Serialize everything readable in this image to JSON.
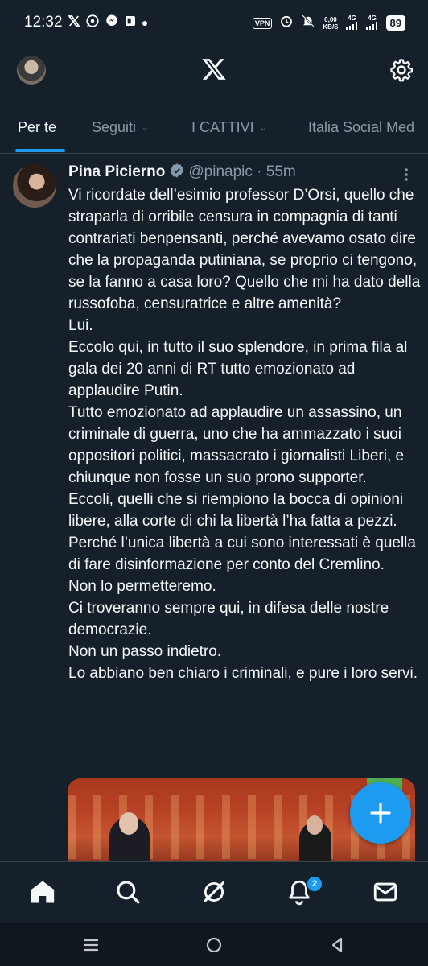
{
  "status_bar": {
    "time": "12:32",
    "left_icons": [
      "x-icon",
      "whatsapp-icon",
      "messenger-icon",
      "app-icon",
      "dot-icon"
    ],
    "vpn": "VPN",
    "net_speed_value": "0,00",
    "net_speed_unit": "KB/S",
    "net1": "4G",
    "net2": "4G",
    "battery": "89"
  },
  "top_bar": {
    "logo": "x-logo-icon",
    "settings_icon": "gear-icon"
  },
  "tabs": [
    {
      "label": "Per te",
      "active": true
    },
    {
      "label": "Seguiti",
      "active": false
    },
    {
      "label": "I CATTIVI",
      "active": false
    },
    {
      "label": "Italia Social Med",
      "active": false
    }
  ],
  "post": {
    "author_name": "Pina Picierno",
    "handle": "@pinapic",
    "separator": "·",
    "time": "55m",
    "lines": [
      "Vi ricordate dell’esimio professor D’Orsi, quello che straparla di orribile censura in compagnia di tanti contrariati benpensanti, perché avevamo osato dire che la propaganda putiniana, se proprio ci tengono, se la fanno a casa loro? Quello che mi ha dato della russofoba, censuratrice e altre amenità?",
      "Lui.",
      "Eccolo qui, in tutto il suo splendore, in prima fila al gala dei 20 anni di RT tutto emozionato ad applaudire Putin.",
      "Tutto emozionato ad applaudire un assassino, un criminale di guerra, uno che ha ammazzato i suoi oppositori politici, massacrato i giornalisti Liberi, e chiunque non fosse un suo prono supporter.",
      "Eccoli, quelli che si riempiono la bocca di opinioni libere, alla corte di chi la libertà l’ha fatta a pezzi. Perché l’unica libertà a cui sono interessati è quella di fare disinformazione per conto del Cremlino.",
      "Non lo permetteremo.",
      "Ci troveranno sempre qui, in difesa delle nostre democrazie.",
      "Non un passo indietro.",
      "Lo abbiano ben chiaro i criminali, e pure i loro servi."
    ]
  },
  "fab": {
    "icon": "plus-icon"
  },
  "bottom_nav": {
    "items": [
      "home-icon",
      "search-icon",
      "grok-icon",
      "notifications-icon",
      "messages-icon"
    ],
    "notifications_badge": "2"
  },
  "colors": {
    "background": "#15202b",
    "accent": "#1d9bf0",
    "secondary_text": "#8b98a5",
    "divider": "#38444d"
  }
}
